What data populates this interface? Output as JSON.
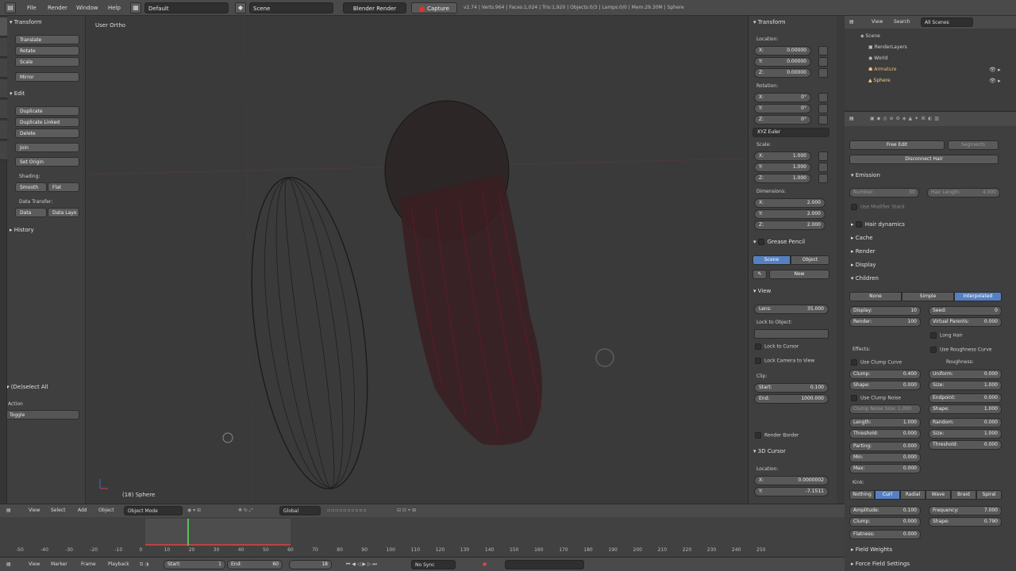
{
  "topbar": {
    "menus": [
      "File",
      "Render",
      "Window",
      "Help"
    ],
    "layout": "Default",
    "scene": "Scene",
    "engine": "Blender Render",
    "capture": "Capture",
    "stats": "v2.74 | Verts:964 | Faces:1,024 | Tris:1,920 | Objects:0/3 | Lamps:0/0 | Mem:29.30M | Sphere"
  },
  "toolshelf": {
    "transform_header": "Transform",
    "transform_buttons": [
      "Translate",
      "Rotate",
      "Scale"
    ],
    "mirror": "Mirror",
    "edit_header": "Edit",
    "edit_buttons": [
      "Duplicate",
      "Duplicate Linked",
      "Delete"
    ],
    "join": "Join",
    "set_origin": "Set Origin",
    "shading_label": "Shading:",
    "smooth": "Smooth",
    "flat": "Flat",
    "data_transfer_label": "Data Transfer:",
    "data": "Data",
    "data_layout": "Data Layo",
    "history": "History",
    "operator_header": "(De)select All",
    "action_label": "Action",
    "action_value": "Toggle"
  },
  "viewport": {
    "label": "User Ortho",
    "object_label": "(18) Sphere"
  },
  "npanel": {
    "transform": "Transform",
    "location_label": "Location:",
    "location": [
      {
        "k": "X:",
        "v": "0.00000"
      },
      {
        "k": "Y:",
        "v": "0.00000"
      },
      {
        "k": "Z:",
        "v": "0.00000"
      }
    ],
    "rotation_label": "Rotation:",
    "rotation": [
      {
        "k": "X:",
        "v": "0°"
      },
      {
        "k": "Y:",
        "v": "0°"
      },
      {
        "k": "Z:",
        "v": "0°"
      }
    ],
    "rotation_mode": "XYZ Euler",
    "scale_label": "Scale:",
    "scale": [
      {
        "k": "X:",
        "v": "1.000"
      },
      {
        "k": "Y:",
        "v": "1.000"
      },
      {
        "k": "Z:",
        "v": "1.000"
      }
    ],
    "dimensions_label": "Dimensions:",
    "dimensions": [
      {
        "k": "X:",
        "v": "2.000"
      },
      {
        "k": "Y:",
        "v": "2.000"
      },
      {
        "k": "Z:",
        "v": "2.000"
      }
    ],
    "grease_pencil": "Grease Pencil",
    "scene_btn": "Scene",
    "object_btn": "Object",
    "new_btn": "New",
    "view": "View",
    "lens": {
      "k": "Lens:",
      "v": "35.000"
    },
    "lock_to_object": "Lock to Object:",
    "lock_to_cursor": "Lock to Cursor",
    "lock_camera": "Lock Camera to View",
    "clip_label": "Clip:",
    "clip": [
      {
        "k": "Start:",
        "v": "0.100"
      },
      {
        "k": "End:",
        "v": "1000.000"
      }
    ],
    "render_border": "Render Border",
    "cursor": "3D Cursor",
    "cursor_location": "Location:",
    "cursor_vals": [
      {
        "k": "X:",
        "v": "0.0000002"
      },
      {
        "k": "Y:",
        "v": "-7.1511"
      }
    ]
  },
  "outliner": {
    "view": "View",
    "search": "Search",
    "filter": "All Scenes",
    "items": [
      "Scene",
      "RenderLayers",
      "World",
      "Armature",
      "Sphere"
    ]
  },
  "props": {
    "free_edit": "Free Edit",
    "segments": "Segments",
    "disconnect": "Disconnect Hair",
    "emission": "Emission",
    "number": {
      "k": "Number:",
      "v": "50"
    },
    "hair_length": {
      "k": "Hair Length:",
      "v": "4.000"
    },
    "use_modifier": "Use Modifier Stack",
    "hair_dynamics": "Hair dynamics",
    "cache": "Cache",
    "render": "Render",
    "display": "Display",
    "children": "Children",
    "child_modes": [
      "None",
      "Simple",
      "Interpolated"
    ],
    "display_amt": {
      "k": "Display:",
      "v": "10"
    },
    "render_amt": {
      "k": "Render:",
      "v": "100"
    },
    "seed": {
      "k": "Seed:",
      "v": "0"
    },
    "virtual_parents": {
      "k": "Virtual Parents:",
      "v": "0.000"
    },
    "long_hair": "Long Hair",
    "effects": "Effects:",
    "roughness": "Roughness:",
    "use_clump_curve": "Use Clump Curve",
    "use_roughness_curve": "Use Roughness Curve",
    "clump": {
      "k": "Clump:",
      "v": "0.400"
    },
    "shape": {
      "k": "Shape:",
      "v": "0.000"
    },
    "use_clump_noise": "Use Clump Noise",
    "clump_noise_size": "Clump Noise Size: 1.000",
    "uniform": {
      "k": "Uniform:",
      "v": "0.000"
    },
    "size": {
      "k": "Size:",
      "v": "1.000"
    },
    "endpoint": {
      "k": "Endpoint:",
      "v": "0.000"
    },
    "shape2": {
      "k": "Shape:",
      "v": "1.000"
    },
    "random": {
      "k": "Random:",
      "v": "0.000"
    },
    "size2": {
      "k": "Size:",
      "v": "1.000"
    },
    "threshold2": {
      "k": "Threshold:",
      "v": "0.000"
    },
    "length": {
      "k": "Length:",
      "v": "1.000"
    },
    "threshold": {
      "k": "Threshold:",
      "v": "0.000"
    },
    "parting": {
      "k": "Parting:",
      "v": "0.000"
    },
    "min": {
      "k": "Min:",
      "v": "0.000"
    },
    "max": {
      "k": "Max:",
      "v": "0.000"
    },
    "kink": "Kink:",
    "kink_modes": [
      "Nothing",
      "Curl",
      "Radial",
      "Wave",
      "Braid",
      "Spiral"
    ],
    "amplitude": {
      "k": "Amplitude:",
      "v": "0.100"
    },
    "frequency": {
      "k": "Frequency:",
      "v": "7.000"
    },
    "kclump": {
      "k": "Clump:",
      "v": "0.000"
    },
    "kshape": {
      "k": "Shape:",
      "v": "0.790"
    },
    "flatness": {
      "k": "Flatness:",
      "v": "0.000"
    },
    "field_weights": "Field Weights",
    "force_field": "Force Field Settings"
  },
  "view_header": {
    "menus": [
      "View",
      "Select",
      "Add",
      "Object"
    ],
    "mode": "Object Mode",
    "orientation": "Global"
  },
  "timeline": {
    "ticks": [
      "-50",
      "-40",
      "-30",
      "-20",
      "-10",
      "0",
      "10",
      "20",
      "30",
      "40",
      "50",
      "60",
      "70",
      "80",
      "90",
      "100",
      "110",
      "120",
      "130",
      "140",
      "150",
      "160",
      "170",
      "180",
      "190",
      "200",
      "210",
      "220",
      "230",
      "240",
      "250"
    ],
    "menus": [
      "View",
      "Marker",
      "Frame",
      "Playback"
    ],
    "start": {
      "k": "Start:",
      "v": "1"
    },
    "end": {
      "k": "End:",
      "v": "60"
    },
    "current": "18",
    "sync": "No Sync"
  }
}
